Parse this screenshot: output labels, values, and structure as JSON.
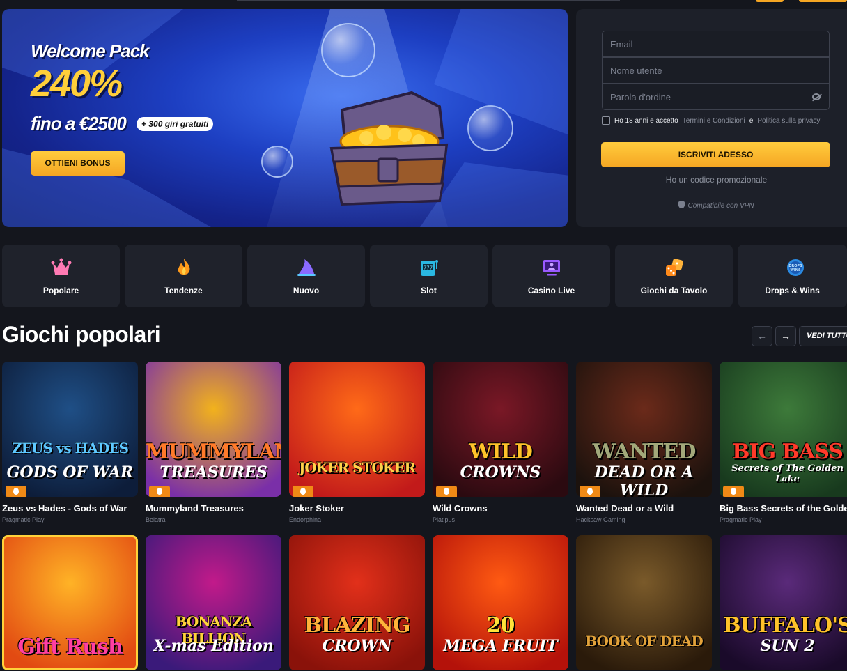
{
  "hero": {
    "title": "Welcome Pack",
    "percent": "240%",
    "amount": "fino a €2500",
    "spins": "+ 300 giri gratuiti",
    "cta": "OTTIENI BONUS"
  },
  "register": {
    "email_placeholder": "Email",
    "username_placeholder": "Nome utente",
    "password_placeholder": "Parola d'ordine",
    "agree_prefix": "Ho 18 anni e accetto",
    "terms_link": "Termini e Condizioni",
    "agree_and": "e",
    "privacy_link": "Politica sulla privacy",
    "submit": "ISCRIVITI ADESSO",
    "promo": "Ho un codice promozionale",
    "vpn": "Compatibile con VPN"
  },
  "categories": [
    {
      "label": "Popolare",
      "icon": "crown-icon"
    },
    {
      "label": "Tendenze",
      "icon": "flame-icon"
    },
    {
      "label": "Nuovo",
      "icon": "shark-fin-icon"
    },
    {
      "label": "Slot",
      "icon": "slot-machine-icon"
    },
    {
      "label": "Casino Live",
      "icon": "live-screen-icon"
    },
    {
      "label": "Giochi da Tavolo",
      "icon": "dice-icon"
    },
    {
      "label": "Drops & Wins",
      "icon": "drops-wins-icon"
    }
  ],
  "section": {
    "title": "Giochi popolari",
    "see_all": "VEDI TUTTO",
    "prev_arrow": "←",
    "next_arrow": "→"
  },
  "games_row1": [
    {
      "name": "Zeus vs Hades - Gods of War",
      "provider": "Pragmatic Play",
      "art": "ZEUS vs HADES",
      "art_sub": "GODS OF WAR",
      "bg1": "#1f4f86",
      "bg2": "#0d1d3a",
      "fg": "#5ec8ff"
    },
    {
      "name": "Mummyland Treasures",
      "provider": "Belatra",
      "art": "MUMMYLAND",
      "art_sub": "TREASURES",
      "bg1": "#f2b21c",
      "bg2": "#7a2fa8",
      "fg": "#ff7a2a"
    },
    {
      "name": "Joker Stoker",
      "provider": "Endorphina",
      "art": "JOKER STOKER",
      "art_sub": "",
      "bg1": "#ff6a18",
      "bg2": "#c21a1a",
      "fg": "#ffd14a"
    },
    {
      "name": "Wild Crowns",
      "provider": "Platipus",
      "art": "WILD",
      "art_sub": "CROWNS",
      "bg1": "#7a1826",
      "bg2": "#2b0a10",
      "fg": "#ffc22a"
    },
    {
      "name": "Wanted Dead or a Wild",
      "provider": "Hacksaw Gaming",
      "art": "WANTED",
      "art_sub": "DEAD OR A WILD",
      "bg1": "#6b2a1a",
      "bg2": "#1c120d",
      "fg": "#a2a87a"
    },
    {
      "name": "Big Bass Secrets of the Golden Lake",
      "provider": "Pragmatic Play",
      "art": "BIG BASS",
      "art_sub": "Secrets of The Golden Lake",
      "bg1": "#3d7a3a",
      "bg2": "#183a1e",
      "fg": "#ff3a2a"
    }
  ],
  "games_row2": [
    {
      "name": "Gift Rush",
      "art": "Gift Rush",
      "art_sub": "",
      "bg1": "#ffb326",
      "bg2": "#e24a12",
      "fg": "#ff3fa2"
    },
    {
      "name": "Bonanza Billion X-mas Edition",
      "art": "BONANZA BILLION",
      "art_sub": "X-mas Edition",
      "bg1": "#c21a8a",
      "bg2": "#3a1a7a",
      "fg": "#ffd23a"
    },
    {
      "name": "Blazing Crown",
      "art": "BLAZING",
      "art_sub": "CROWN",
      "bg1": "#e2301a",
      "bg2": "#8a120a",
      "fg": "#ffb33a"
    },
    {
      "name": "20 Mega Fruit",
      "art": "20",
      "art_sub": "MEGA FRUIT",
      "bg1": "#ff5a12",
      "bg2": "#b4120a",
      "fg": "#ffe23a"
    },
    {
      "name": "Book of Dead",
      "art": "BOOK OF DEAD",
      "art_sub": "",
      "bg1": "#7a5a2a",
      "bg2": "#2a1a0a",
      "fg": "#e2a23a"
    },
    {
      "name": "Buffalo's Sun 2",
      "art": "BUFFALO'S",
      "art_sub": "SUN 2",
      "bg1": "#5a2a7a",
      "bg2": "#1a0a2a",
      "fg": "#ffc22a"
    }
  ]
}
